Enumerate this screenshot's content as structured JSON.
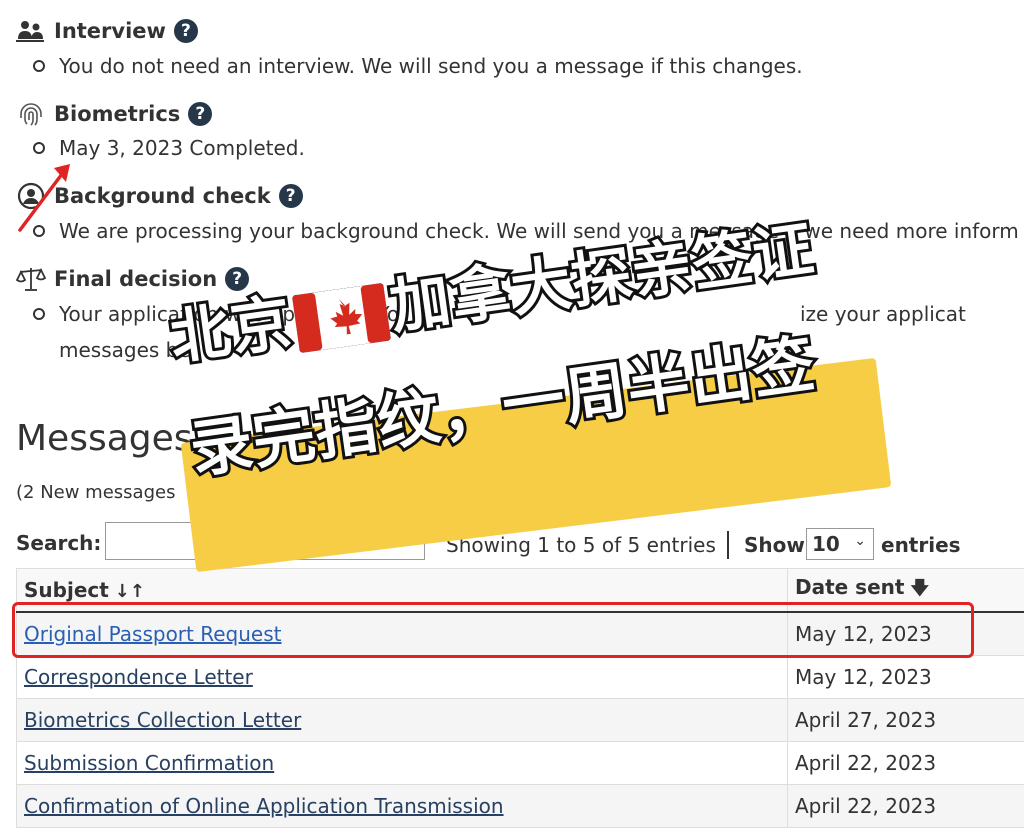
{
  "sections": {
    "interview": {
      "title": "Interview",
      "status": "You do not need an interview. We will send you a message if this changes."
    },
    "biometrics": {
      "title": "Biometrics",
      "status": "May 3, 2023 Completed."
    },
    "background": {
      "title": "Background check",
      "status": "We are processing your background check. We will send you a message if we need more inform"
    },
    "final": {
      "title": "Final decision",
      "status_line1": "Your application was approved. Yo",
      "status_line1_end": "ize your applicat",
      "status_line2": "messages be"
    }
  },
  "help_icon_glyph": "?",
  "messages": {
    "heading": "Messages a",
    "new_count": "(2 New messages"
  },
  "table_controls": {
    "search_label": "Search:",
    "search_value": "",
    "showing": "Showing 1 to 5 of 5 entries",
    "show_label": "Show",
    "page_size": "10",
    "entries_label": "entries"
  },
  "table": {
    "headers": {
      "subject": "Subject",
      "date": "Date sent"
    },
    "rows": [
      {
        "subject": "Original Passport Request",
        "date": "May 12, 2023"
      },
      {
        "subject": "Correspondence Letter",
        "date": "May 12, 2023"
      },
      {
        "subject": "Biometrics Collection Letter",
        "date": "April 27, 2023"
      },
      {
        "subject": "Submission Confirmation",
        "date": "April 22, 2023"
      },
      {
        "subject": "Confirmation of Online Application Transmission",
        "date": "April 22, 2023"
      }
    ]
  },
  "overlay": {
    "line1_prefix": "北京",
    "line1_suffix": "加拿大探亲签证",
    "line2": "录完指纹，一周半出签"
  },
  "colors": {
    "help_icon": "#26374a",
    "link": "#284162",
    "annotation_red": "#e02424",
    "banner_yellow": "#f7cd46",
    "flag_red": "#d52b1e"
  },
  "icons": {
    "interview": "people-icon",
    "biometrics": "fingerprint-icon",
    "background": "person-check-icon",
    "final": "scales-icon"
  }
}
